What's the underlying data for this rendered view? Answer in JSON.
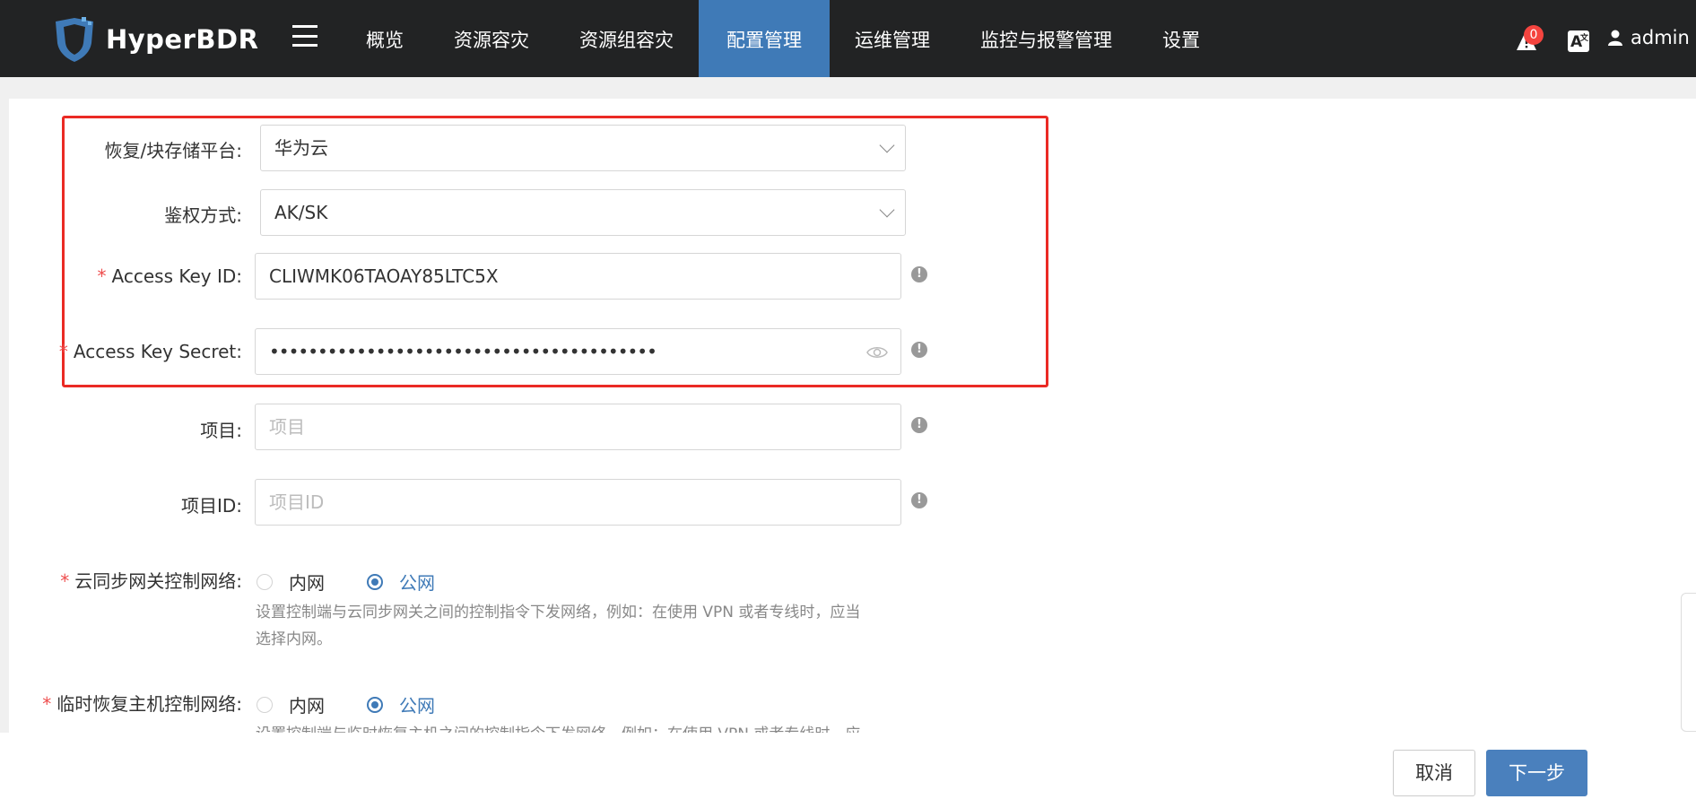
{
  "app": {
    "brand": "HyperBDR"
  },
  "nav": {
    "menu_icon": "hamburger-icon",
    "items": [
      "概览",
      "资源容灾",
      "资源组容灾",
      "配置管理",
      "运维管理",
      "监控与报警管理",
      "设置"
    ],
    "active": "配置管理"
  },
  "header": {
    "alert_count": "0",
    "user": "admin"
  },
  "form": {
    "platform_label": "恢复/块存储平台:",
    "platform_value": "华为云",
    "auth_label": "鉴权方式:",
    "auth_value": "AK/SK",
    "access_key_id_label": "Access Key ID:",
    "access_key_id_value": "CLIWMK06TAOAY85LTC5X",
    "access_key_secret_label": "Access Key Secret:",
    "access_key_secret_value": "••••••••••••••••••••••••••••••••••••••••",
    "project_label": "项目:",
    "project_placeholder": "项目",
    "project_id_label": "项目ID:",
    "project_id_placeholder": "项目ID",
    "gateway_network_label": "云同步网关控制网络:",
    "gateway_network_options": [
      "内网",
      "公网"
    ],
    "gateway_network_selected": "公网",
    "gateway_network_help_line1": "设置控制端与云同步网关之间的控制指令下发网络，例如：在使用 VPN 或者专线时，应当",
    "gateway_network_help_line2": "选择内网。",
    "host_network_label": "临时恢复主机控制网络:",
    "host_network_options": [
      "内网",
      "公网"
    ],
    "host_network_selected": "公网",
    "host_network_help_partial": "设置控制端与临时恢复主机之间的控制指令下发网络，例如：在使用 VPN 或者专线时，应"
  },
  "footer": {
    "cancel": "取消",
    "next": "下一步"
  },
  "colors": {
    "topbar": "#222324",
    "active_nav": "#3f7ab7",
    "highlight_box": "#ea2a24",
    "primary_button": "#4a80bd"
  }
}
